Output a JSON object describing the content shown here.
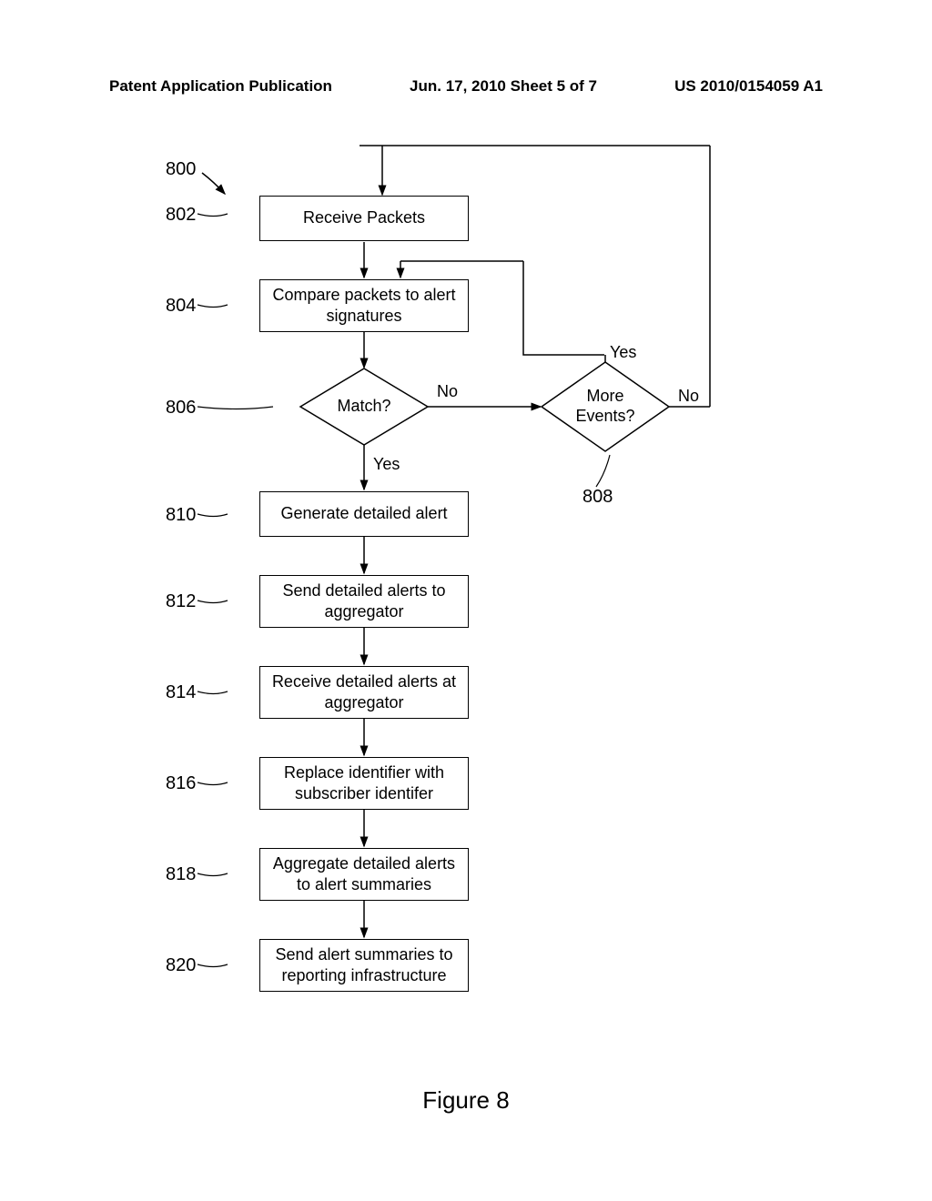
{
  "header": {
    "left": "Patent Application Publication",
    "center": "Jun. 17, 2010  Sheet 5 of 7",
    "right": "US 2010/0154059 A1"
  },
  "refs": {
    "r800": "800",
    "r802": "802",
    "r804": "804",
    "r806": "806",
    "r808": "808",
    "r810": "810",
    "r812": "812",
    "r814": "814",
    "r816": "816",
    "r818": "818",
    "r820": "820"
  },
  "boxes": {
    "b802": "Receive Packets",
    "b804": "Compare packets to alert signatures",
    "b806": "Match?",
    "b808": "More Events?",
    "b810": "Generate detailed alert",
    "b812": "Send detailed alerts to aggregator",
    "b814": "Receive detailed alerts at aggregator",
    "b816": "Replace identifier with subscriber identifer",
    "b818": "Aggregate detailed alerts to alert summaries",
    "b820": "Send alert summaries to reporting infrastructure"
  },
  "labels": {
    "no1": "No",
    "yes1": "Yes",
    "yes2": "Yes",
    "no2": "No"
  },
  "caption": "Figure 8"
}
